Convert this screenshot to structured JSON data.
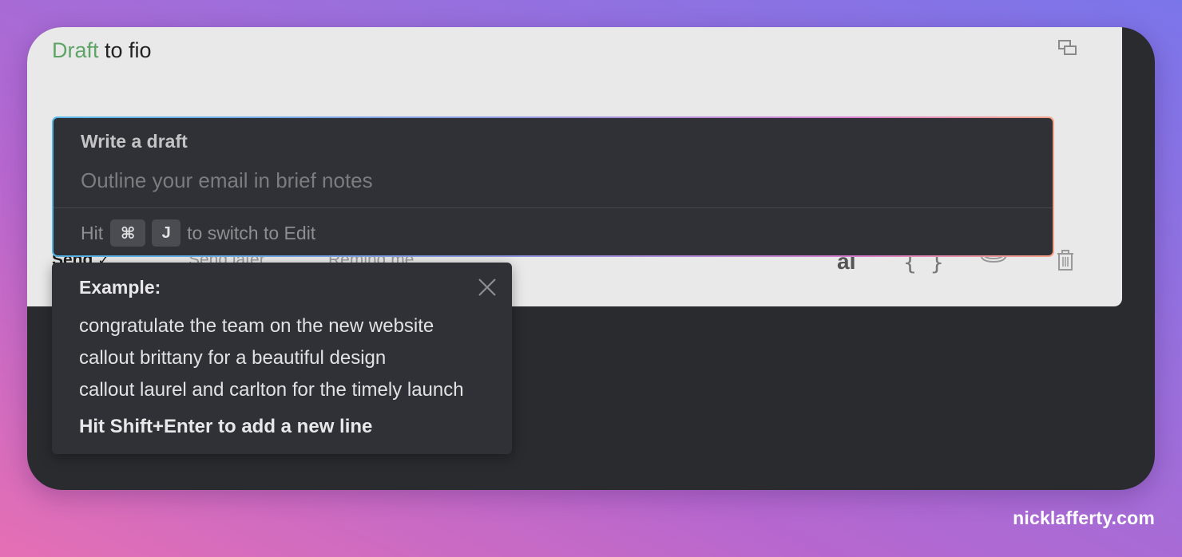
{
  "header": {
    "title_accent": "Draft",
    "title_rest": "to fio"
  },
  "toolbar": {
    "send_label": "Send",
    "send_later_label": "Send later",
    "remind_me_label": "Remind me",
    "ai_label": "aI",
    "snippet_label": "{ }"
  },
  "draft": {
    "label": "Write a draft",
    "placeholder": "Outline your email in brief notes",
    "value": "",
    "hint_prefix": "Hit",
    "key_cmd": "⌘",
    "key_j": "J",
    "hint_suffix": "to switch to Edit"
  },
  "example": {
    "title": "Example:",
    "lines": [
      "congratulate the team on the new website",
      "callout brittany for a beautiful design",
      "callout laurel and carlton for the timely launch"
    ],
    "footer": "Hit Shift+Enter to add a new line"
  },
  "watermark": "nicklafferty.com",
  "colors": {
    "accent_green": "#5ea466",
    "panel_dark": "#303136",
    "window_dark": "#2a2b2f",
    "compose_light": "#e9e9e9"
  },
  "icons": {
    "popout": "popout-icon",
    "dropdown": "chevron-down-icon",
    "close": "close-icon",
    "attach": "attach-icon",
    "trash": "trash-icon"
  }
}
